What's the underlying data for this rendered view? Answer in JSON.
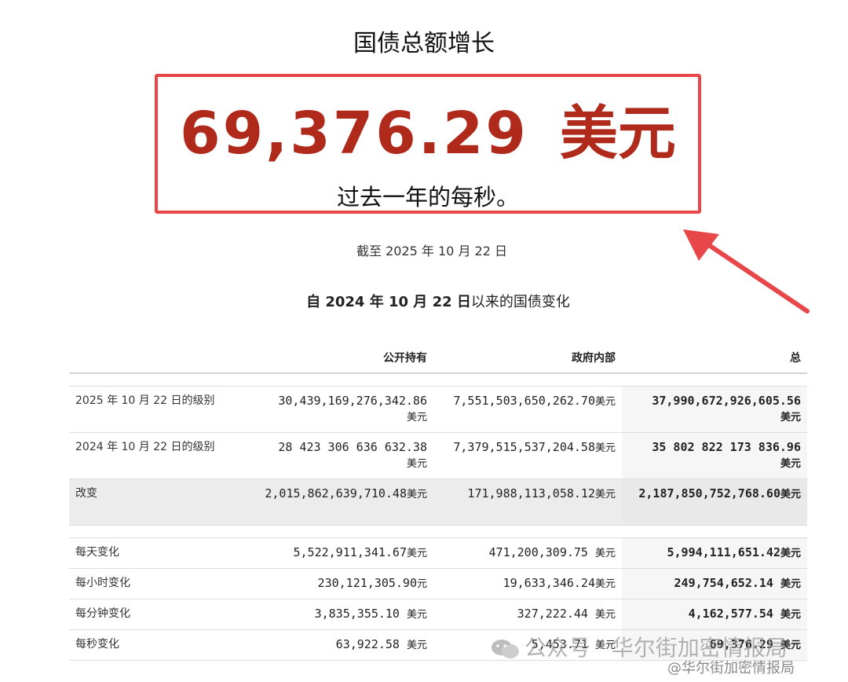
{
  "header": {
    "title": "国债总额增长"
  },
  "highlight": {
    "amount": "69,376.29",
    "unit": "美元",
    "caption": "过去一年的每秒。"
  },
  "as_of": "截至 2025 年 10 月 22 日",
  "section": {
    "title_bold": "自 2024 年 10 月 22 日",
    "title_rest": "以来的国债变化"
  },
  "table": {
    "columns": [
      "",
      "公开持有",
      "政府内部",
      "总"
    ],
    "rows": [
      {
        "label": "2025 年 10 月 22 日的级别",
        "public": "30,439,169,276,342.86",
        "public_unit": "美元",
        "intra": "7,551,503,650,262.70",
        "intra_unit": "美元",
        "total": "37,990,672,926,605.56",
        "total_unit": "美元"
      },
      {
        "label": "2024 年 10 月 22 日的级别",
        "public": "28 423 306 636 632.38",
        "public_unit": "美元",
        "intra": "7,379,515,537,204.58",
        "intra_unit": "美元",
        "total": "35 802 822 173 836.96",
        "total_unit": "美元"
      },
      {
        "label": "改变",
        "public": "2,015,862,639,710.48",
        "public_unit": "美元",
        "intra": "171,988,113,058.12",
        "intra_unit": "美元",
        "total": "2,187,850,752,768.60",
        "total_unit": "美元"
      },
      {
        "label": "每天变化",
        "public": "5,522,911,341.67",
        "public_unit": "美元",
        "intra": "471,200,309.75 ",
        "intra_unit": "美元",
        "total": "5,994,111,651.42",
        "total_unit": "美元"
      },
      {
        "label": "每小时变化",
        "public": "230,121,305.90",
        "public_unit": "元",
        "intra": "19,633,346.24",
        "intra_unit": "美元",
        "total": "249,754,652.14 ",
        "total_unit": "美元"
      },
      {
        "label": "每分钟变化",
        "public": "3,835,355.10 ",
        "public_unit": "美元",
        "intra": "327,222.44 ",
        "intra_unit": "美元",
        "total": "4,162,577.54 ",
        "total_unit": "美元"
      },
      {
        "label": "每秒变化",
        "public": "63,922.58 ",
        "public_unit": "美元",
        "intra": "5,453.71 ",
        "intra_unit": "美元",
        "total": "69,376.29 ",
        "total_unit": "美元"
      }
    ]
  },
  "watermark": {
    "main": "公众号 · 华尔街加密情报局",
    "sub": "@华尔街加密情报局"
  },
  "colors": {
    "accent_red": "#b02a1c",
    "box_border": "#e8474a",
    "arrow": "#e8474a"
  }
}
